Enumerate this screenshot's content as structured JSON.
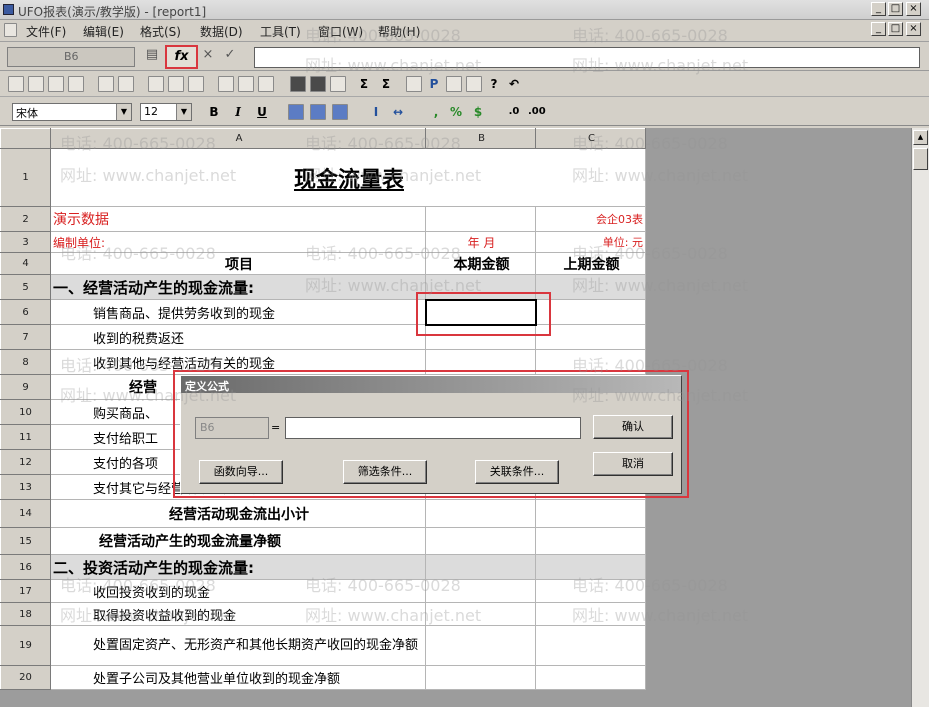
{
  "window": {
    "title": "UFO报表(演示/教学版) - [report1]",
    "min": "_",
    "max": "□",
    "close": "×"
  },
  "menu": [
    "文件(F)",
    "编辑(E)",
    "格式(S)",
    "数据(D)",
    "工具(T)",
    "窗口(W)",
    "帮助(H)"
  ],
  "formula_bar": {
    "cell_ref": "B6",
    "fx": "fx",
    "cancel": "×",
    "ok": "✓"
  },
  "format_bar": {
    "font": "宋体",
    "size": "12",
    "bold": "B",
    "italic": "I",
    "underline": "U"
  },
  "sheet": {
    "columns": [
      "A",
      "B",
      "C"
    ],
    "title": "现金流量表",
    "demo": "演示数据",
    "code": "会企03表",
    "unit_label": "编制单位:",
    "year_month": "年   月",
    "currency": "单位: 元",
    "head_item": "项目",
    "head_current": "本期金额",
    "head_prior": "上期金额",
    "rows": {
      "r5": "一、经营活动产生的现金流量:",
      "r6": "销售商品、提供劳务收到的现金",
      "r7": "收到的税费返还",
      "r8": "收到其他与经营活动有关的现金",
      "r9": "经营",
      "r10": "购买商品、",
      "r11": "支付给职工",
      "r12": "支付的各项",
      "r13": "支付其它与经营活动有关的现金",
      "r14": "经营活动现金流出小计",
      "r15": "经营活动产生的现金流量净额",
      "r16": "二、投资活动产生的现金流量:",
      "r17": "收回投资收到的现金",
      "r18": "取得投资收益收到的现金",
      "r19": "处置固定资产、无形资产和其他长期资产收回的现金净额",
      "r20": "处置子公司及其他营业单位收到的现金净额"
    }
  },
  "dialog": {
    "title": "定义公式",
    "cell": "B6",
    "equals": "=",
    "confirm": "确认",
    "cancel": "取消",
    "func_wizard": "函数向导...",
    "filter": "筛选条件...",
    "relation": "关联条件..."
  },
  "watermarks": {
    "phone": "电话: 400-665-0028",
    "site": "网址: www.chanjet.net"
  },
  "colors": {
    "highlight": "#d9363e",
    "red_text": "#d82020"
  }
}
